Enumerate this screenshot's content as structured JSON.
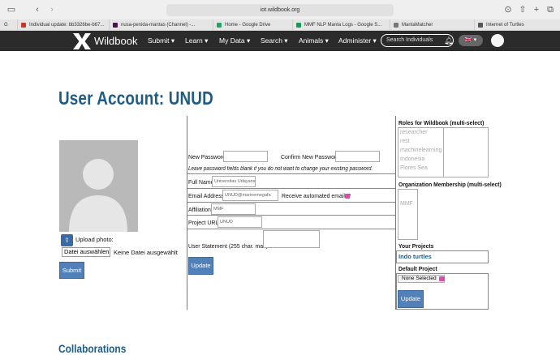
{
  "browser": {
    "url": "iot.wildbook.org",
    "tabs": [
      {
        "label": "Individual update: bb3326be-b67...",
        "color": "#c5372c"
      },
      {
        "label": "nusa-penida-mantas (Channel) -...",
        "color": "#4a154b"
      },
      {
        "label": "Home - Google Drive",
        "color": "#1fa463"
      },
      {
        "label": "MMF NLP Manta Logs - Google S...",
        "color": "#0f9d58"
      },
      {
        "label": "MantaMatcher",
        "color": "#777777"
      },
      {
        "label": "Internet of Turtles",
        "color": "#555555"
      }
    ]
  },
  "nav": {
    "brand": "Wildbook",
    "items": [
      "Submit",
      "Learn",
      "My Data",
      "Search",
      "Animals",
      "Administer"
    ],
    "search_placeholder": "Search Individuals"
  },
  "page": {
    "title": "User Account: UNUD",
    "upload_label": "Upload photo:",
    "file_button": "Datei auswählen",
    "file_status": "Keine Datei ausgewählt",
    "submit_label": "Submit",
    "collaborations": "Collaborations"
  },
  "form": {
    "new_password_label": "New Password:",
    "confirm_password_label": "Confirm New Password:",
    "password_hint": "Leave password fields blank if you do not want to change your existing password.",
    "full_name_label": "Full Name",
    "full_name_value": "Universitas Udayana",
    "email_label": "Email Address",
    "email_value": "UNUD@marinemegafa",
    "receive_email_label": "Receive automated emails?",
    "affiliation_label": "Affiliation",
    "affiliation_value": "MMF",
    "project_url_label": "Project URL:",
    "project_url_value": "UNUD",
    "statement_label": "User Statement (255 char. max):",
    "update_label": "Update"
  },
  "sidebar": {
    "roles_label": "Roles for Wildbook (multi-select)",
    "roles": [
      "researcher",
      "rest",
      "machinelearning",
      "Indonesia",
      "Flores Sea"
    ],
    "org_label": "Organization Membership (multi-select)",
    "org_value": "MMF",
    "projects_label": "Your Projects",
    "project_item": "Indo turtles",
    "default_project_label": "Default Project",
    "default_project_value": "None Selected",
    "update_label": "Update"
  },
  "colors": {
    "accent": "#1e5c88",
    "button": "#5181b8",
    "nav_bg": "#2b2b2b",
    "checkbox": "#d94cae"
  }
}
